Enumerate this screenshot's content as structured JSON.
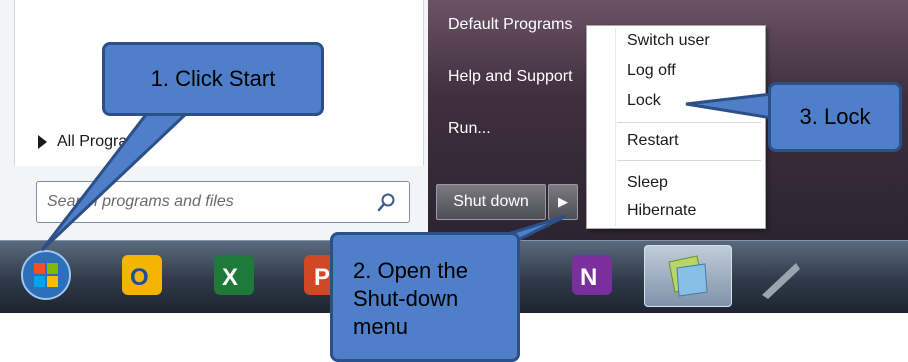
{
  "start_menu": {
    "all_programs_label": "All Programs",
    "search_placeholder": "Search programs and files"
  },
  "right_pane": {
    "default_programs": "Default Programs",
    "help_support": "Help and Support",
    "run": "Run...",
    "shutdown_label": "Shut down",
    "shutdown_arrow": "▶"
  },
  "shutdown_menu": {
    "items": [
      "Switch user",
      "Log off",
      "Lock",
      "Restart",
      "Sleep",
      "Hibernate"
    ]
  },
  "taskbar": {
    "icons": [
      "start-orb-icon",
      "outlook-icon",
      "excel-icon",
      "powerpoint-icon",
      "onenote-icon",
      "sticky-notes-icon",
      "snipping-tool-icon"
    ]
  },
  "callouts": {
    "step1": "1. Click Start",
    "step2": "2. Open the Shut-down menu",
    "step3": "3. Lock"
  },
  "colors": {
    "callout_fill": "#4f7fc8",
    "callout_border": "#2b4f86",
    "menu_bg": "#ffffff"
  }
}
